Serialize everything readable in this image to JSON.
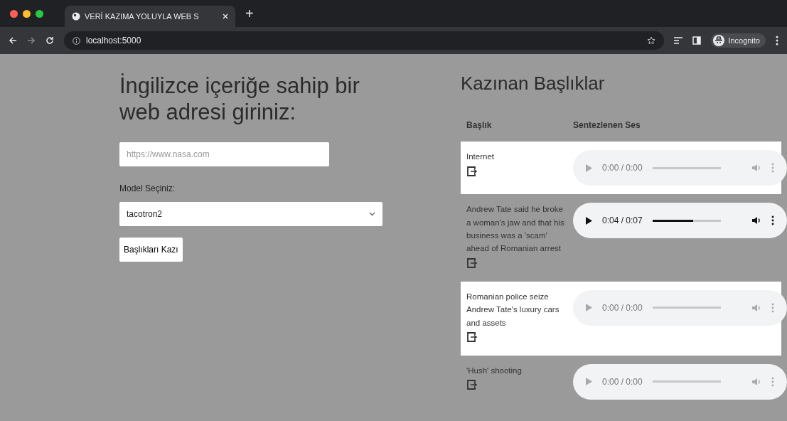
{
  "browser": {
    "tab_title": "VERİ KAZIMA YOLUYLA WEB S",
    "new_tab": "+",
    "url": "localhost:5000",
    "profile": "Incognito"
  },
  "form": {
    "heading": "İngilizce içeriğe sahip bir web adresi giriniz:",
    "url_placeholder": "https://www.nasa.com",
    "model_label": "Model Seçiniz:",
    "model_value": "tacotron2",
    "submit": "Başlıkları Kazı"
  },
  "results": {
    "title": "Kazınan Başlıklar",
    "columns": [
      "Başlık",
      "Sentezlenen Ses"
    ],
    "rows": [
      {
        "headline": "Internet",
        "audio": {
          "time": "0:00 / 0:00",
          "loaded": false,
          "level": 0
        }
      },
      {
        "headline": "Andrew Tate said he broke a woman's jaw and that his business was a 'scam' ahead of Romanian arrest",
        "audio": {
          "time": "0:04 / 0:07",
          "loaded": true,
          "level": 0.6
        }
      },
      {
        "headline": "Romanian police seize Andrew Tate's luxury cars and assets",
        "audio": {
          "time": "0:00 / 0:00",
          "loaded": false,
          "level": 0
        }
      },
      {
        "headline": "'Hush' shooting",
        "audio": {
          "time": "0:00 / 0:00",
          "loaded": false,
          "level": 0
        }
      }
    ]
  }
}
